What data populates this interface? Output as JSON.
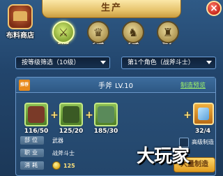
{
  "title": "生产",
  "shop": {
    "label": "布料商店",
    "icon": "cloth-shop-icon"
  },
  "tabs": [
    {
      "label": "武器",
      "icon": "sword-icon",
      "glyph": "⚔",
      "active": true
    },
    {
      "label": "头盔",
      "icon": "helmet-icon",
      "glyph": "♛",
      "active": false
    },
    {
      "label": "衣服",
      "icon": "armor-icon",
      "glyph": "♞",
      "active": false
    },
    {
      "label": "鞋子",
      "icon": "boots-icon",
      "glyph": "♜",
      "active": false
    }
  ],
  "filters": {
    "level": "按等级筛选（10级）",
    "character": "第1个角色（战斧斗士）"
  },
  "item": {
    "tag": "推荐",
    "name": "手斧",
    "level": "LV.10",
    "preview": "制造预览",
    "materials": [
      {
        "count": "116/50",
        "icon": "leather-material-icon",
        "color": "#7a3a28"
      },
      {
        "count": "125/20",
        "icon": "herb-material-icon",
        "color": "#3a5a24"
      },
      {
        "count": "185/30",
        "icon": "cloth-material-icon",
        "color": "#5a8a5a"
      }
    ],
    "product_count": "32/4",
    "product_icon": "crystal-icon",
    "info": [
      {
        "key": "部位",
        "value": "武器"
      },
      {
        "key": "职业",
        "value": "战斧斗士"
      },
      {
        "key": "消耗",
        "value": "125"
      }
    ],
    "checkbox_label": "高级制造",
    "make_button": "大量制造"
  },
  "close_label": "×",
  "watermark": "大玩家"
}
